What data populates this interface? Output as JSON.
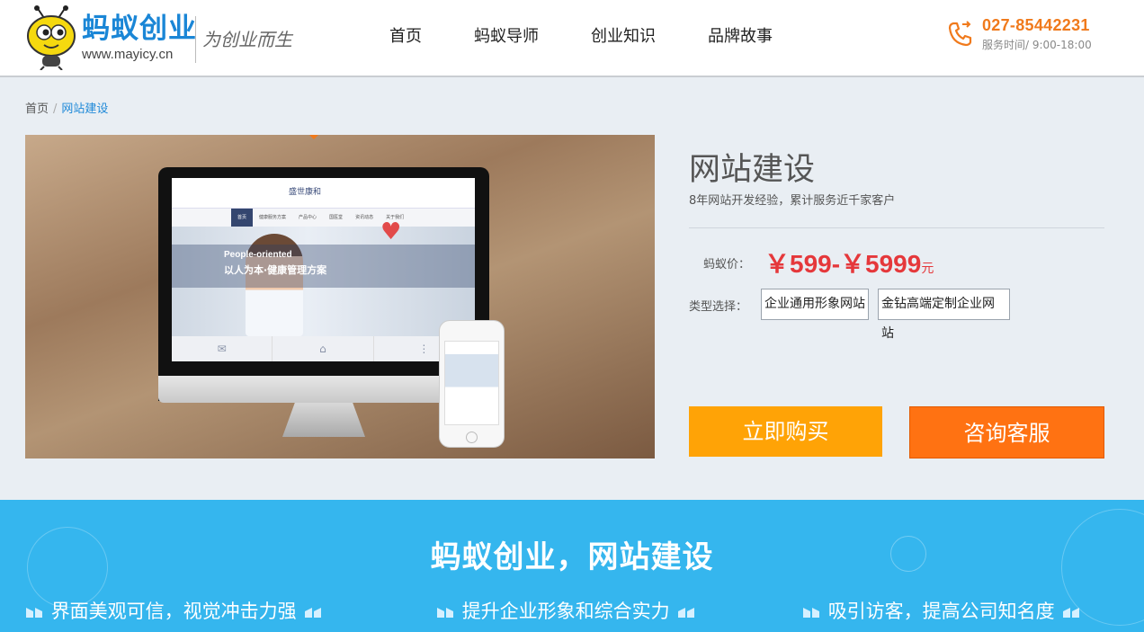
{
  "header": {
    "brand": "蚂蚁创业",
    "domain": "www.mayicy.cn",
    "slogan": "为创业而生",
    "nav": [
      "首页",
      "蚂蚁导师",
      "创业知识",
      "品牌故事"
    ],
    "phone": "027-85442231",
    "hours": "服务时间/ 9:00-18:00"
  },
  "breadcrumb": {
    "home": "首页",
    "sep": "/",
    "current": "网站建设"
  },
  "hero": {
    "screen_logo": "盛世康和",
    "screen_nav": [
      "首页",
      "健康服务方案",
      "产品中心",
      "国医堂",
      "资讯动态",
      "关于我们"
    ],
    "band_text1": "People-oriented",
    "band_text2": "以人为本·健康管理方案"
  },
  "product": {
    "title": "网站建设",
    "subtitle": "8年网站开发经验，累计服务近千家客户",
    "price_label": "蚂蚁价：",
    "price": "￥599-￥5999",
    "price_unit": "元",
    "type_label": "类型选择：",
    "options": [
      "企业通用形象网站",
      "金钻高端定制企业网站"
    ],
    "buy_label": "立即购买",
    "consult_label": "咨询客服"
  },
  "promo": {
    "headline": "蚂蚁创业，网站建设",
    "features": [
      "界面美观可信，视觉冲击力强",
      "提升企业形象和综合实力",
      "吸引访客，提高公司知名度"
    ]
  },
  "colors": {
    "brand_blue": "#1a86d6",
    "accent_orange": "#f07a1c",
    "price_red": "#e5383b",
    "buy": "#ffa306",
    "consult": "#ff7212",
    "promo_bg": "#35b6ee"
  }
}
